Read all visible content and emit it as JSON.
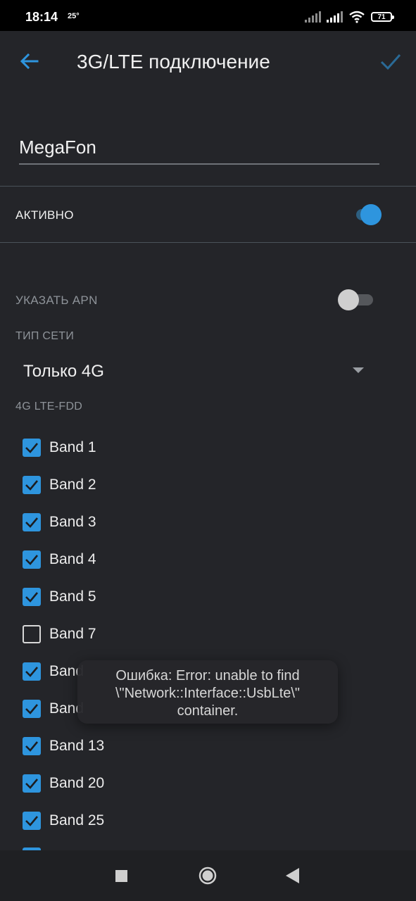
{
  "status_bar": {
    "time": "18:14",
    "temperature": "25°",
    "battery": "71"
  },
  "app_bar": {
    "title": "3G/LTE подключение",
    "back_icon": "arrow-left-icon",
    "save_icon": "check-icon"
  },
  "name_field": {
    "value": "MegaFon"
  },
  "active": {
    "label": "АКТИВНО",
    "on": true
  },
  "apn": {
    "label": "УКАЗАТЬ APN",
    "on": false
  },
  "network_type": {
    "label": "ТИП СЕТИ",
    "selected": "Только 4G"
  },
  "lte_section": {
    "label": "4G LTE-FDD",
    "bands": [
      {
        "label": "Band 1",
        "checked": true
      },
      {
        "label": "Band 2",
        "checked": true
      },
      {
        "label": "Band 3",
        "checked": true
      },
      {
        "label": "Band 4",
        "checked": true
      },
      {
        "label": "Band 5",
        "checked": true
      },
      {
        "label": "Band 7",
        "checked": false
      },
      {
        "label": "Band",
        "checked": true
      },
      {
        "label": "Band",
        "checked": true
      },
      {
        "label": "Band 13",
        "checked": true
      },
      {
        "label": "Band 20",
        "checked": true
      },
      {
        "label": "Band 25",
        "checked": true
      }
    ]
  },
  "toast": {
    "line1": "Ошибка: Error: unable to find",
    "line2": "\\\"Network::Interface::UsbLte\\\"",
    "line3": "container."
  },
  "colors": {
    "accent": "#2e95de",
    "background": "#242529",
    "status_bar": "#000000"
  }
}
